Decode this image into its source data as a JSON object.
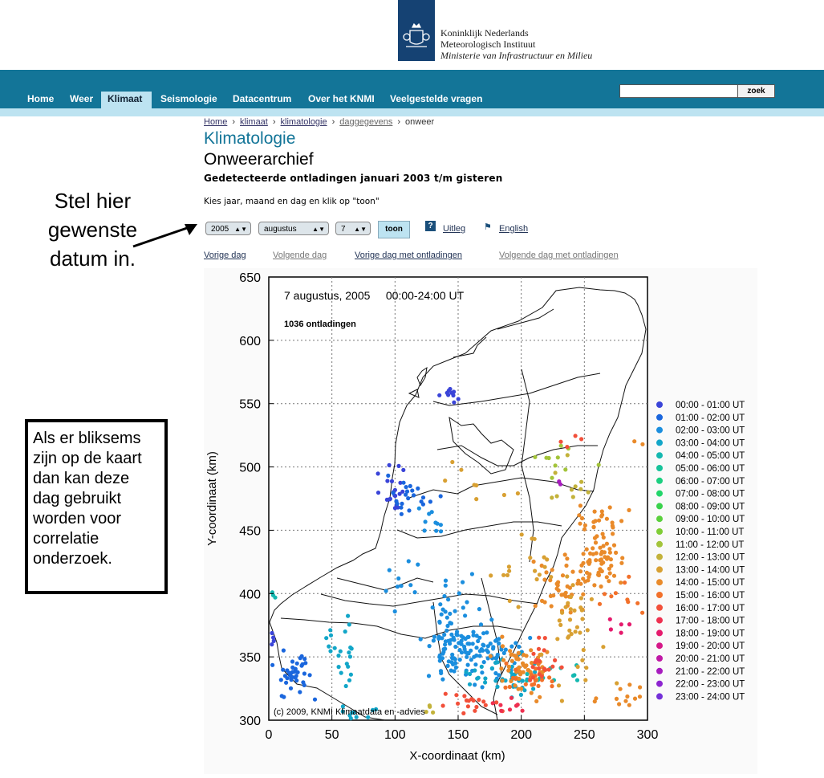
{
  "header": {
    "logo_lines": [
      "Koninklijk Nederlands",
      "Meteorologisch Instituut",
      "Ministerie van Infrastructuur en Milieu"
    ]
  },
  "nav": {
    "items": [
      "Home",
      "Weer",
      "Klimaat",
      "Seismologie",
      "Datacentrum",
      "Over het KNMI",
      "Veelgestelde vragen"
    ],
    "active": "Klimaat",
    "search_button": "zoek",
    "search_value": ""
  },
  "breadcrumb": [
    "Home",
    "klimaat",
    "klimatologie",
    "daggegevens",
    "onweer"
  ],
  "section_title": "Klimatologie",
  "page_title": "Onweerarchief",
  "subtitle": "Gedetecteerde ontladingen januari 2003 t/m gisteren",
  "instruction": "Kies jaar, maand en dag en klik op \"toon\"",
  "form": {
    "year": "2005",
    "month": "augustus",
    "day": "7",
    "toon": "toon",
    "help": "Uitleg",
    "english": "English",
    "help_icon": "question-icon",
    "flag_icon": "flag-icon"
  },
  "day_links": [
    "Vorige dag",
    "Volgende dag",
    "Vorige dag met ontladingen",
    "Volgende dag met ontladingen"
  ],
  "annotations": {
    "top": [
      "Stel hier",
      "gewenste",
      "datum in."
    ],
    "box": [
      "Als er bliksems",
      "zijn op de kaart",
      "dan kan deze",
      "dag gebruikt",
      "worden voor",
      "correlatie",
      "onderzoek."
    ]
  },
  "colors": {
    "nav": "#137598",
    "nav_strip": "#bde3f1",
    "title": "#137598",
    "logo": "#154273"
  },
  "chart_data": {
    "type": "scatter",
    "title": "7 augustus, 2005     00:00-24:00 UT",
    "annotation": "1036 ontladingen",
    "copyright": "(c) 2009, KNMI Klimaatdata en -advies",
    "xlabel": "X-coordinaat (km)",
    "ylabel": "Y-coordinaat (km)",
    "xlim": [
      0,
      300
    ],
    "ylim": [
      300,
      650
    ],
    "xticks": [
      0,
      50,
      100,
      150,
      200,
      250,
      300
    ],
    "yticks": [
      300,
      350,
      400,
      450,
      500,
      550,
      600,
      650
    ],
    "grid": true,
    "legend_position": "right",
    "legend": [
      {
        "label": "00:00 - 01:00 UT",
        "color": "#3a44d8"
      },
      {
        "label": "01:00 - 02:00 UT",
        "color": "#1a66dd"
      },
      {
        "label": "02:00 - 03:00 UT",
        "color": "#1b8ede"
      },
      {
        "label": "03:00 - 04:00 UT",
        "color": "#12a6c8"
      },
      {
        "label": "04:00 - 05:00 UT",
        "color": "#14b8b0"
      },
      {
        "label": "05:00 - 06:00 UT",
        "color": "#17c39a"
      },
      {
        "label": "06:00 - 07:00 UT",
        "color": "#1ccf80"
      },
      {
        "label": "07:00 - 08:00 UT",
        "color": "#22d56a"
      },
      {
        "label": "08:00 - 09:00 UT",
        "color": "#3ad24c"
      },
      {
        "label": "09:00 - 10:00 UT",
        "color": "#5ad03c"
      },
      {
        "label": "10:00 - 11:00 UT",
        "color": "#7fcd36"
      },
      {
        "label": "11:00 - 12:00 UT",
        "color": "#a3c43a"
      },
      {
        "label": "12:00 - 13:00 UT",
        "color": "#c3b23a"
      },
      {
        "label": "13:00 - 14:00 UT",
        "color": "#d8a032"
      },
      {
        "label": "14:00 - 15:00 UT",
        "color": "#e98a2a"
      },
      {
        "label": "15:00 - 16:00 UT",
        "color": "#f2702a"
      },
      {
        "label": "16:00 - 17:00 UT",
        "color": "#f2503a"
      },
      {
        "label": "17:00 - 18:00 UT",
        "color": "#ee3050"
      },
      {
        "label": "18:00 - 19:00 UT",
        "color": "#e51a6c"
      },
      {
        "label": "19:00 - 20:00 UT",
        "color": "#d51788"
      },
      {
        "label": "20:00 - 21:00 UT",
        "color": "#c018a6"
      },
      {
        "label": "21:00 - 22:00 UT",
        "color": "#a71bbe"
      },
      {
        "label": "22:00 - 23:00 UT",
        "color": "#8d24d0"
      },
      {
        "label": "23:00 - 24:00 UT",
        "color": "#7430d8"
      }
    ],
    "clusters": [
      {
        "hour": 0,
        "x": 2,
        "y": 362,
        "n": 4,
        "sx": 3,
        "sy": 4
      },
      {
        "hour": 1,
        "x": 20,
        "y": 335,
        "n": 40,
        "sx": 9,
        "sy": 9
      },
      {
        "hour": 0,
        "x": 98,
        "y": 484,
        "n": 20,
        "sx": 5,
        "sy": 8
      },
      {
        "hour": 1,
        "x": 112,
        "y": 478,
        "n": 22,
        "sx": 9,
        "sy": 8
      },
      {
        "hour": 0,
        "x": 145,
        "y": 556,
        "n": 10,
        "sx": 5,
        "sy": 3
      },
      {
        "hour": 2,
        "x": 130,
        "y": 448,
        "n": 10,
        "sx": 8,
        "sy": 8
      },
      {
        "hour": 2,
        "x": 100,
        "y": 410,
        "n": 10,
        "sx": 8,
        "sy": 10
      },
      {
        "hour": 2,
        "x": 150,
        "y": 395,
        "n": 24,
        "sx": 12,
        "sy": 13
      },
      {
        "hour": 2,
        "x": 150,
        "y": 357,
        "n": 90,
        "sx": 13,
        "sy": 12
      },
      {
        "hour": 2,
        "x": 180,
        "y": 352,
        "n": 40,
        "sx": 11,
        "sy": 9
      },
      {
        "hour": 3,
        "x": 185,
        "y": 335,
        "n": 40,
        "sx": 14,
        "sy": 8
      },
      {
        "hour": 3,
        "x": 60,
        "y": 350,
        "n": 22,
        "sx": 6,
        "sy": 15
      },
      {
        "hour": 3,
        "x": 70,
        "y": 307,
        "n": 10,
        "sx": 10,
        "sy": 3
      },
      {
        "hour": 4,
        "x": 225,
        "y": 333,
        "n": 12,
        "sx": 12,
        "sy": 5
      },
      {
        "hour": 14,
        "x": 200,
        "y": 340,
        "n": 55,
        "sx": 10,
        "sy": 10
      },
      {
        "hour": 15,
        "x": 205,
        "y": 332,
        "n": 20,
        "sx": 12,
        "sy": 6
      },
      {
        "hour": 16,
        "x": 215,
        "y": 345,
        "n": 20,
        "sx": 8,
        "sy": 9
      },
      {
        "hour": 16,
        "x": 155,
        "y": 312,
        "n": 18,
        "sx": 12,
        "sy": 4
      },
      {
        "hour": 17,
        "x": 190,
        "y": 315,
        "n": 8,
        "sx": 8,
        "sy": 5
      },
      {
        "hour": 13,
        "x": 250,
        "y": 335,
        "n": 10,
        "sx": 20,
        "sy": 20
      },
      {
        "hour": 14,
        "x": 265,
        "y": 428,
        "n": 55,
        "sx": 8,
        "sy": 12
      },
      {
        "hour": 14,
        "x": 235,
        "y": 405,
        "n": 45,
        "sx": 10,
        "sy": 12
      },
      {
        "hour": 13,
        "x": 240,
        "y": 378,
        "n": 25,
        "sx": 8,
        "sy": 14
      },
      {
        "hour": 12,
        "x": 245,
        "y": 480,
        "n": 10,
        "sx": 10,
        "sy": 20
      },
      {
        "hour": 11,
        "x": 225,
        "y": 510,
        "n": 10,
        "sx": 15,
        "sy": 8
      },
      {
        "hour": 14,
        "x": 265,
        "y": 460,
        "n": 20,
        "sx": 10,
        "sy": 6
      },
      {
        "hour": 13,
        "x": 200,
        "y": 420,
        "n": 18,
        "sx": 12,
        "sy": 12
      },
      {
        "hour": 15,
        "x": 280,
        "y": 400,
        "n": 10,
        "sx": 8,
        "sy": 10
      },
      {
        "hour": 18,
        "x": 275,
        "y": 380,
        "n": 5,
        "sx": 6,
        "sy": 6
      },
      {
        "hour": 14,
        "x": 280,
        "y": 320,
        "n": 12,
        "sx": 10,
        "sy": 5
      },
      {
        "hour": 13,
        "x": 160,
        "y": 485,
        "n": 8,
        "sx": 15,
        "sy": 10
      },
      {
        "hour": 4,
        "x": 4,
        "y": 400,
        "n": 3,
        "sx": 2,
        "sy": 2
      },
      {
        "hour": 16,
        "x": 240,
        "y": 520,
        "n": 4,
        "sx": 5,
        "sy": 3
      },
      {
        "hour": 14,
        "x": 292,
        "y": 520,
        "n": 2,
        "sx": 2,
        "sy": 2
      },
      {
        "hour": 21,
        "x": 231,
        "y": 490,
        "n": 2,
        "sx": 2,
        "sy": 2
      },
      {
        "hour": 12,
        "x": 130,
        "y": 310,
        "n": 4,
        "sx": 6,
        "sy": 2
      }
    ]
  }
}
